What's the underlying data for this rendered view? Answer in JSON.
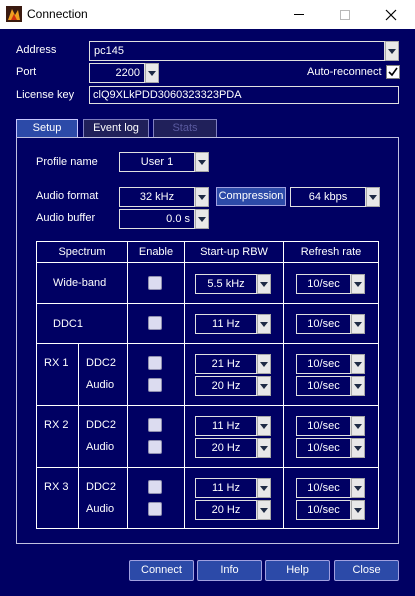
{
  "window": {
    "title": "Connection"
  },
  "form": {
    "address_label": "Address",
    "address_value": "pc145",
    "port_label": "Port",
    "port_value": "2200",
    "auto_reconnect_label": "Auto-reconnect",
    "auto_reconnect_checked": true,
    "license_label": "License key",
    "license_value": "clQ9XLkPDD3060323323PDA"
  },
  "tabs": [
    {
      "label": "Setup",
      "state": "active"
    },
    {
      "label": "Event log",
      "state": "inactive"
    },
    {
      "label": "Stats",
      "state": "disabled"
    }
  ],
  "setup": {
    "profile_label": "Profile name",
    "profile_value": "User 1",
    "audio_format_label": "Audio format",
    "audio_format_value": "32 kHz",
    "compression_label": "Compression",
    "compression_value": "64 kbps",
    "audio_buffer_label": "Audio buffer",
    "audio_buffer_value": "0.0 s"
  },
  "table": {
    "headers": {
      "spectrum": "Spectrum",
      "enable": "Enable",
      "rbw": "Start-up RBW",
      "refresh": "Refresh rate"
    },
    "rows": [
      {
        "group": "",
        "label": "Wide-band",
        "rbw": "5.5 kHz",
        "refresh": "10/sec"
      },
      {
        "group": "",
        "label": "DDC1",
        "rbw": "11 Hz",
        "refresh": "10/sec"
      },
      {
        "group": "RX 1",
        "label": "DDC2",
        "rbw": "21 Hz",
        "refresh": "10/sec"
      },
      {
        "group": "",
        "label": "Audio",
        "rbw": "20 Hz",
        "refresh": "10/sec"
      },
      {
        "group": "RX 2",
        "label": "DDC2",
        "rbw": "11 Hz",
        "refresh": "10/sec"
      },
      {
        "group": "",
        "label": "Audio",
        "rbw": "20 Hz",
        "refresh": "10/sec"
      },
      {
        "group": "RX 3",
        "label": "DDC2",
        "rbw": "11 Hz",
        "refresh": "10/sec"
      },
      {
        "group": "",
        "label": "Audio",
        "rbw": "20 Hz",
        "refresh": "10/sec"
      }
    ]
  },
  "buttons": {
    "connect": "Connect",
    "info": "Info",
    "help": "Help",
    "close": "Close"
  },
  "colors": {
    "background": "#000063",
    "accent": "#2c4aa8"
  },
  "icons": [
    "app-icon",
    "minimize-icon",
    "maximize-icon",
    "close-icon",
    "dropdown-arrow-icon",
    "checkmark-icon"
  ]
}
